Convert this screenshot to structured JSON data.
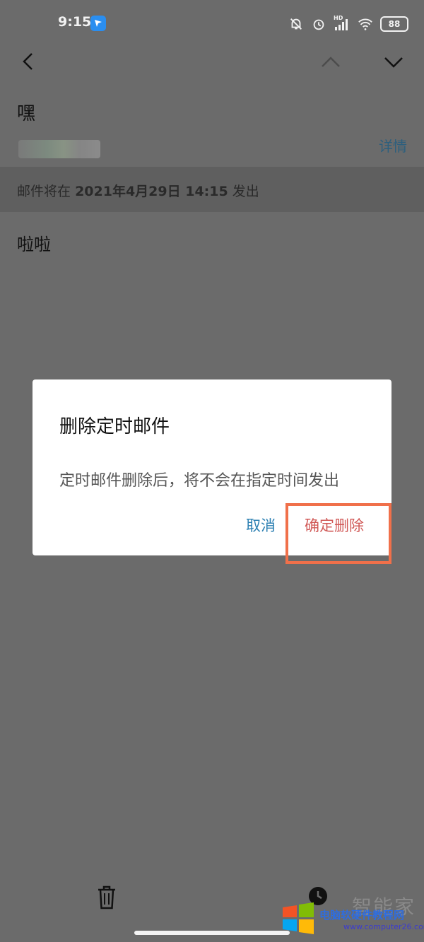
{
  "status_bar": {
    "time": "9:15",
    "battery": "88",
    "hd_label": "HD",
    "icons": [
      "notifications-off-icon",
      "alarm-icon",
      "signal-icon",
      "wifi-icon",
      "battery-icon"
    ]
  },
  "toolbar": {
    "icons": [
      "back-chevron-icon",
      "previous-chevron-icon",
      "next-chevron-icon"
    ]
  },
  "email": {
    "subject": "嘿",
    "details_link": "详情",
    "schedule_prefix": "邮件将在",
    "schedule_datetime": "2021年4月29日 14:15",
    "schedule_suffix": "发出",
    "body": "啦啦"
  },
  "dialog": {
    "title": "删除定时邮件",
    "message": "定时邮件删除后，将不会在指定时间发出",
    "cancel_label": "取消",
    "confirm_label": "确定删除"
  },
  "bottom_bar": {
    "icons": [
      "trash-icon",
      "clock-icon"
    ]
  },
  "watermark": {
    "text": "电脑软硬件教程网",
    "url": "www.computer26.com",
    "big_text": "智能家"
  },
  "colors": {
    "overlay_background": "#6b6b6b",
    "link_blue": "#2b7fb2",
    "danger_red": "#d15a58",
    "highlight_orange": "#f0704a"
  }
}
